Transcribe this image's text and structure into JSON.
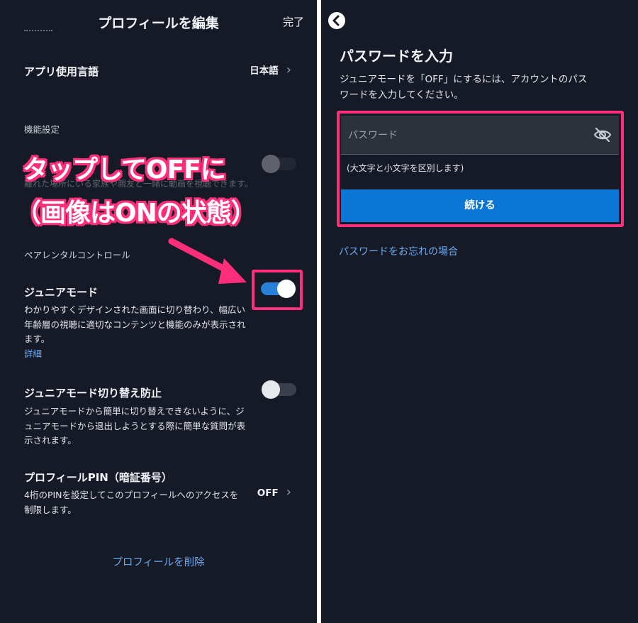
{
  "left": {
    "header": {
      "title": "プロフィールを編集",
      "done_label": "完了"
    },
    "language": {
      "label": "アプリ使用言語",
      "value": "日本語"
    },
    "features_section": "機能設定",
    "hidden_desc": "離れた場所にいる家族や親友と一緒に動画を視聴できます。",
    "parental_section": "ペアレンタルコントロール",
    "junior": {
      "title": "ジュニアモード",
      "desc_lines": [
        "わかりやすくデザインされた画面に切り替わり、幅広い",
        "年齢層の視聴に適切なコンテンツと機能のみが表示され",
        "ます。"
      ],
      "more_link": "詳細",
      "toggle_on": true
    },
    "junior_lock": {
      "title": "ジュニアモード切り替え防止",
      "desc_lines": [
        "ジュニアモードから簡単に切り替えできないように、ジ",
        "ュニアモードから退出しようとする際に簡単な質問が表",
        "示されます。"
      ],
      "toggle_on": false
    },
    "pin": {
      "title": "プロフィールPIN（暗証番号）",
      "desc_lines": [
        "4桁のPINを設定してこのプロフィールへのアクセスを",
        "制限します。"
      ],
      "value": "OFF"
    },
    "delete_link": "プロフィールを削除"
  },
  "annotation": {
    "line1": "タップしてOFFに",
    "line2": "（画像はONの状態）",
    "accent_color": "#ff2e7a"
  },
  "right": {
    "title": "パスワードを入力",
    "desc_lines": [
      "ジュニアモードを「OFF」にするには、アカウントのパス",
      "ワードを入力してください。"
    ],
    "password_placeholder": "パスワード",
    "case_hint": "(大文字と小文字を区別します)",
    "continue_label": "続ける",
    "forgot_link": "パスワードをお忘れの場合"
  },
  "colors": {
    "background": "#161a26",
    "toggle_on": "#2a7fd8",
    "button": "#0a76d6",
    "link": "#6aaaf0"
  }
}
